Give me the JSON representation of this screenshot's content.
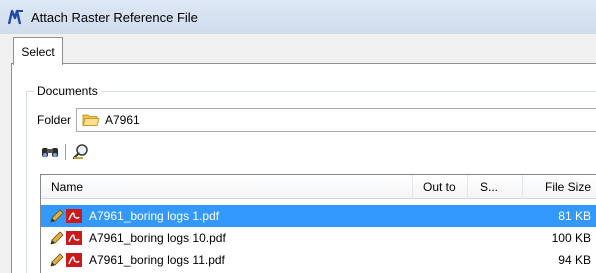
{
  "window": {
    "title": "Attach Raster Reference File"
  },
  "tabs": [
    {
      "label": "Select"
    }
  ],
  "documents": {
    "group_label": "Documents",
    "folder_label": "Folder",
    "folder_value": "A7961"
  },
  "toolbar": {
    "icons": [
      "binoculars-icon",
      "search-magnifier-icon"
    ]
  },
  "list": {
    "columns": [
      "Name",
      "Out to",
      "S...",
      "File Size"
    ],
    "rows": [
      {
        "name": "A7961_boring logs 1.pdf",
        "size": "81 KB",
        "selected": true
      },
      {
        "name": "A7961_boring logs 10.pdf",
        "size": "100 KB",
        "selected": false
      },
      {
        "name": "A7961_boring logs 11.pdf",
        "size": "94 KB",
        "selected": false
      }
    ]
  },
  "colors": {
    "selection": "#3399ff",
    "pdf_red": "#cc1a1a",
    "folder_yellow": "#f5c542"
  }
}
